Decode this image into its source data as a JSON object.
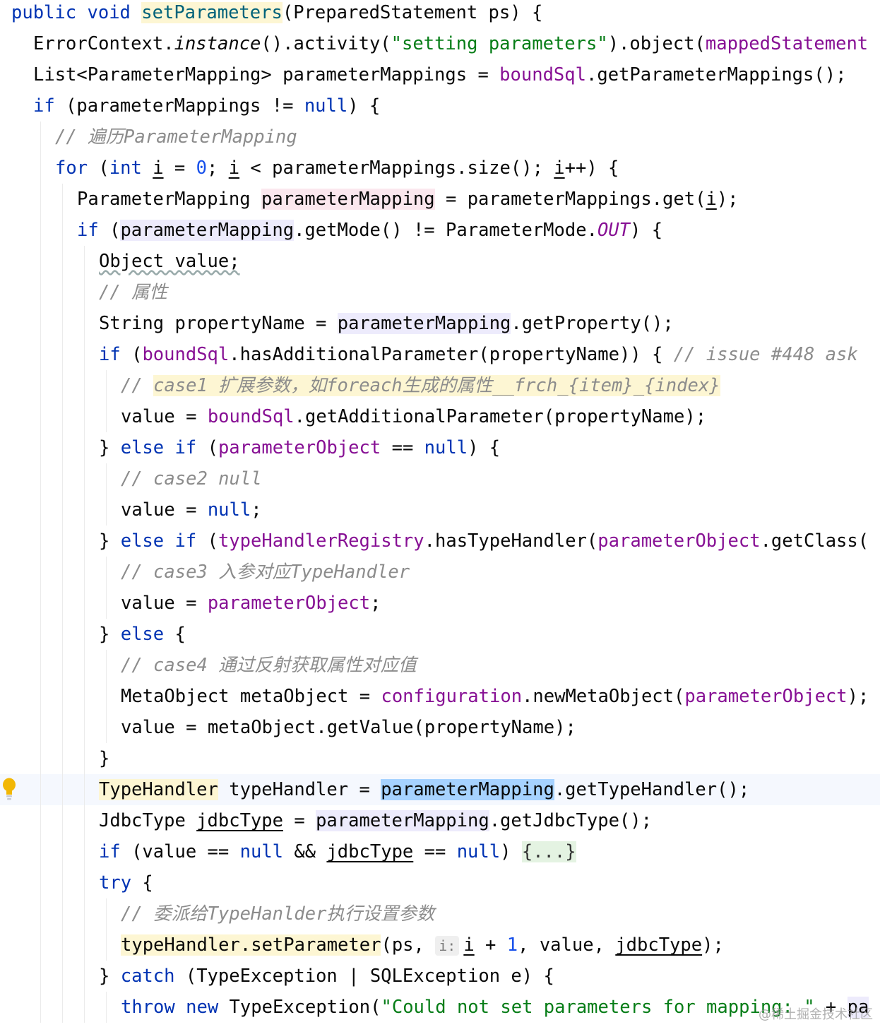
{
  "code_lines": [
    {
      "indent": 0,
      "tokens": [
        {
          "t": "public",
          "c": "kw"
        },
        {
          "t": " "
        },
        {
          "t": "void",
          "c": "kw"
        },
        {
          "t": " "
        },
        {
          "t": "setParameters",
          "c": "fn hl-yellow"
        },
        {
          "t": "(PreparedStatement ps) {"
        }
      ]
    },
    {
      "indent": 1,
      "tokens": [
        {
          "t": "ErrorContext."
        },
        {
          "t": "instance",
          "c": "ital"
        },
        {
          "t": "().activity("
        },
        {
          "t": "\"setting parameters\"",
          "c": "str"
        },
        {
          "t": ").object("
        },
        {
          "t": "mappedStatement",
          "c": "fld"
        }
      ]
    },
    {
      "indent": 1,
      "tokens": [
        {
          "t": "List<ParameterMapping> parameterMappings = "
        },
        {
          "t": "boundSql",
          "c": "fld"
        },
        {
          "t": ".getParameterMappings();"
        }
      ]
    },
    {
      "indent": 1,
      "tokens": [
        {
          "t": "if",
          "c": "kw"
        },
        {
          "t": " (parameterMappings != "
        },
        {
          "t": "null",
          "c": "kw"
        },
        {
          "t": ") {"
        }
      ]
    },
    {
      "indent": 2,
      "tokens": [
        {
          "t": "// 遍历ParameterMapping",
          "c": "cmt"
        }
      ]
    },
    {
      "indent": 2,
      "tokens": [
        {
          "t": "for",
          "c": "kw"
        },
        {
          "t": " ("
        },
        {
          "t": "int",
          "c": "kw"
        },
        {
          "t": " "
        },
        {
          "t": "i",
          "c": "ul"
        },
        {
          "t": " = "
        },
        {
          "t": "0",
          "c": "num"
        },
        {
          "t": "; "
        },
        {
          "t": "i",
          "c": "ul"
        },
        {
          "t": " < parameterMappings.size(); "
        },
        {
          "t": "i",
          "c": "ul"
        },
        {
          "t": "++) {"
        }
      ]
    },
    {
      "indent": 3,
      "tokens": [
        {
          "t": "ParameterMapping "
        },
        {
          "t": "parameterMapping",
          "c": "hl-pink"
        },
        {
          "t": " = parameterMappings.get("
        },
        {
          "t": "i",
          "c": "ul"
        },
        {
          "t": ");"
        }
      ]
    },
    {
      "indent": 3,
      "tokens": [
        {
          "t": "if",
          "c": "kw"
        },
        {
          "t": " ("
        },
        {
          "t": "parameterMapping",
          "c": "hl-lav"
        },
        {
          "t": ".getMode() != ParameterMode."
        },
        {
          "t": "OUT",
          "c": "cnst"
        },
        {
          "t": ") {"
        }
      ]
    },
    {
      "indent": 4,
      "tokens": [
        {
          "t": "Object value;",
          "c": "wavy"
        }
      ]
    },
    {
      "indent": 4,
      "tokens": [
        {
          "t": "// 属性",
          "c": "cmt"
        }
      ]
    },
    {
      "indent": 4,
      "tokens": [
        {
          "t": "String propertyName = "
        },
        {
          "t": "parameterMapping",
          "c": "hl-lav"
        },
        {
          "t": ".getProperty();"
        }
      ]
    },
    {
      "indent": 4,
      "tokens": [
        {
          "t": "if",
          "c": "kw"
        },
        {
          "t": " ("
        },
        {
          "t": "boundSql",
          "c": "fld"
        },
        {
          "t": ".hasAdditionalParameter(propertyName)) { "
        },
        {
          "t": "// issue #448 ask",
          "c": "cmt"
        }
      ]
    },
    {
      "indent": 5,
      "tokens": [
        {
          "t": "// ",
          "c": "cmt"
        },
        {
          "t": "case1 扩展参数，如foreach生成的属性__frch_{item}_{index}",
          "c": "cmt hl-yellow"
        }
      ]
    },
    {
      "indent": 5,
      "tokens": [
        {
          "t": "value = "
        },
        {
          "t": "boundSql",
          "c": "fld"
        },
        {
          "t": ".getAdditionalParameter(propertyName);"
        }
      ]
    },
    {
      "indent": 4,
      "tokens": [
        {
          "t": "} "
        },
        {
          "t": "else",
          "c": "kw"
        },
        {
          "t": " "
        },
        {
          "t": "if",
          "c": "kw"
        },
        {
          "t": " ("
        },
        {
          "t": "parameterObject",
          "c": "fld"
        },
        {
          "t": " == "
        },
        {
          "t": "null",
          "c": "kw"
        },
        {
          "t": ") {"
        }
      ]
    },
    {
      "indent": 5,
      "tokens": [
        {
          "t": "// case2 null",
          "c": "cmt"
        }
      ]
    },
    {
      "indent": 5,
      "tokens": [
        {
          "t": "value = "
        },
        {
          "t": "null",
          "c": "kw"
        },
        {
          "t": ";"
        }
      ]
    },
    {
      "indent": 4,
      "tokens": [
        {
          "t": "} "
        },
        {
          "t": "else",
          "c": "kw"
        },
        {
          "t": " "
        },
        {
          "t": "if",
          "c": "kw"
        },
        {
          "t": " ("
        },
        {
          "t": "typeHandlerRegistry",
          "c": "fld"
        },
        {
          "t": ".hasTypeHandler("
        },
        {
          "t": "parameterObject",
          "c": "fld"
        },
        {
          "t": ".getClass("
        }
      ]
    },
    {
      "indent": 5,
      "tokens": [
        {
          "t": "// case3 入参对应TypeHandler",
          "c": "cmt"
        }
      ]
    },
    {
      "indent": 5,
      "tokens": [
        {
          "t": "value = "
        },
        {
          "t": "parameterObject",
          "c": "fld"
        },
        {
          "t": ";"
        }
      ]
    },
    {
      "indent": 4,
      "tokens": [
        {
          "t": "} "
        },
        {
          "t": "else",
          "c": "kw"
        },
        {
          "t": " {"
        }
      ]
    },
    {
      "indent": 5,
      "tokens": [
        {
          "t": "// case4 通过反射获取属性对应值",
          "c": "cmt"
        }
      ]
    },
    {
      "indent": 5,
      "tokens": [
        {
          "t": "MetaObject metaObject = "
        },
        {
          "t": "configuration",
          "c": "fld"
        },
        {
          "t": ".newMetaObject("
        },
        {
          "t": "parameterObject",
          "c": "fld"
        },
        {
          "t": ");"
        }
      ]
    },
    {
      "indent": 5,
      "tokens": [
        {
          "t": "value = metaObject.getValue(propertyName);"
        }
      ]
    },
    {
      "indent": 4,
      "tokens": [
        {
          "t": "}"
        }
      ]
    },
    {
      "indent": 4,
      "current": true,
      "tokens": [
        {
          "t": "TypeHandler",
          "c": "hl-yellow"
        },
        {
          "t": " typeHandler = "
        },
        {
          "t": "parameterMapping",
          "c": "hl-sel"
        },
        {
          "t": ".getTypeHandler();"
        }
      ]
    },
    {
      "indent": 4,
      "tokens": [
        {
          "t": "JdbcType "
        },
        {
          "t": "jdbcType",
          "c": "ul"
        },
        {
          "t": " = "
        },
        {
          "t": "parameterMapping",
          "c": "hl-lav"
        },
        {
          "t": ".getJdbcType();"
        }
      ]
    },
    {
      "indent": 4,
      "tokens": [
        {
          "t": "if",
          "c": "kw"
        },
        {
          "t": " (value == "
        },
        {
          "t": "null",
          "c": "kw"
        },
        {
          "t": " && "
        },
        {
          "t": "jdbcType",
          "c": "ul"
        },
        {
          "t": " == "
        },
        {
          "t": "null",
          "c": "kw"
        },
        {
          "t": ") "
        },
        {
          "t": "{...}",
          "c": "fold"
        }
      ]
    },
    {
      "indent": 4,
      "tokens": [
        {
          "t": "try",
          "c": "kw"
        },
        {
          "t": " {"
        }
      ]
    },
    {
      "indent": 5,
      "tokens": [
        {
          "t": "// 委派给TypeHanlder执行设置参数",
          "c": "cmt"
        }
      ]
    },
    {
      "indent": 5,
      "tokens": [
        {
          "t": "typeHandler.setParameter",
          "c": "hl-yellow"
        },
        {
          "t": "(ps, "
        },
        {
          "t": "i:",
          "hint": true
        },
        {
          "t": "i",
          "c": "ul"
        },
        {
          "t": " + "
        },
        {
          "t": "1",
          "c": "num"
        },
        {
          "t": ", value, "
        },
        {
          "t": "jdbcType",
          "c": "ul"
        },
        {
          "t": ");"
        }
      ]
    },
    {
      "indent": 4,
      "tokens": [
        {
          "t": "} "
        },
        {
          "t": "catch",
          "c": "kw"
        },
        {
          "t": " (TypeException | SQLException e) {"
        }
      ]
    },
    {
      "indent": 5,
      "tokens": [
        {
          "t": "throw",
          "c": "kw"
        },
        {
          "t": " "
        },
        {
          "t": "new",
          "c": "kw"
        },
        {
          "t": " TypeException("
        },
        {
          "t": "\"Could not set parameters for mapping: \"",
          "c": "str"
        },
        {
          "t": " + "
        },
        {
          "t": "pa",
          "c": "hl-lav"
        }
      ]
    }
  ],
  "gutter": {
    "icon": "lightbulb-icon",
    "line": 25
  },
  "watermark": "@稀土掘金技术社区"
}
